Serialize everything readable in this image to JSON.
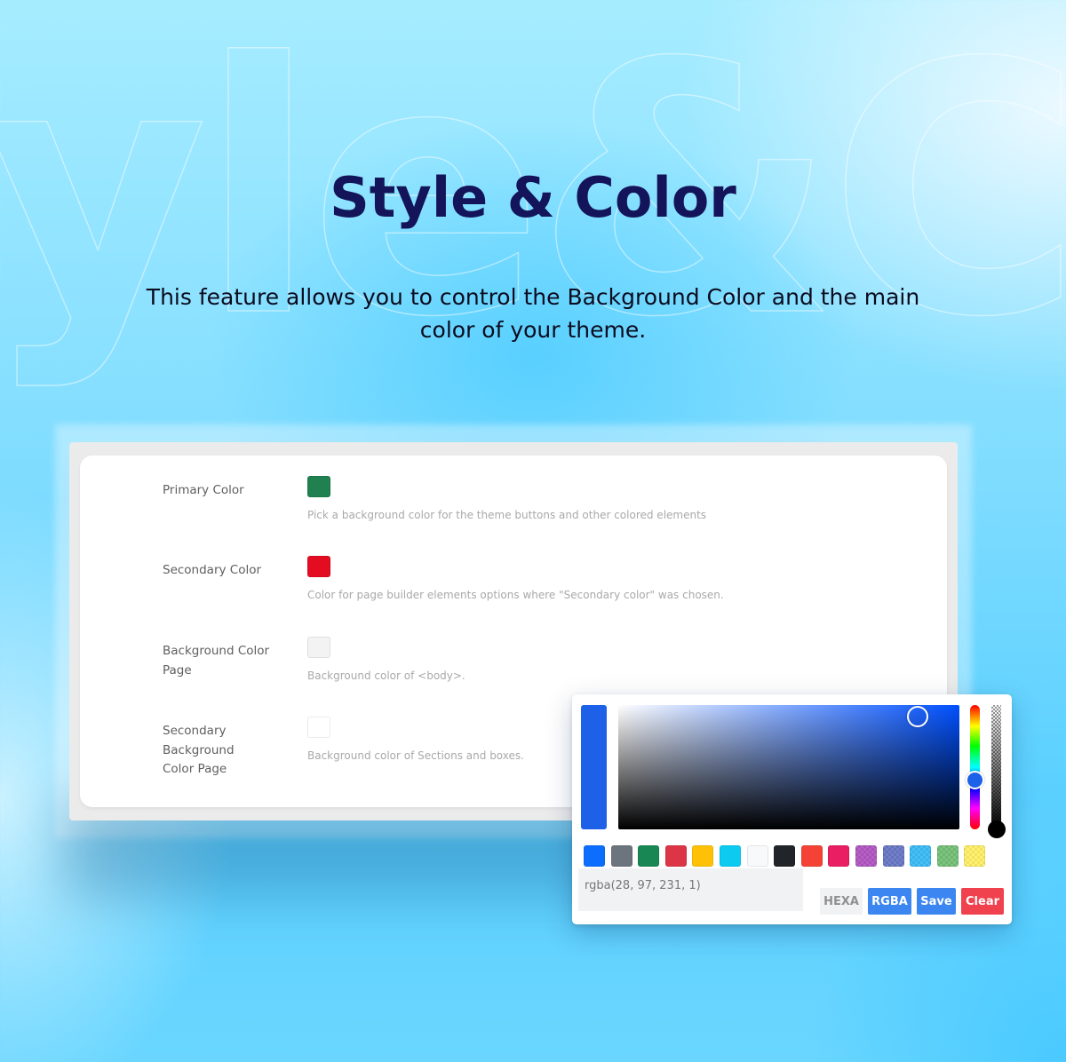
{
  "hero": {
    "watermark": "yle&Co",
    "title": "Style & Color",
    "subtitle": "This feature allows you to control the Background Color and the main color of your theme."
  },
  "settings": {
    "rows": [
      {
        "label": "Primary Color",
        "color": "#21804f",
        "description": "Pick a background color for the theme buttons and other colored elements"
      },
      {
        "label": "Secondary Color",
        "color": "#e30c21",
        "description": "Color for page builder elements options where \"Secondary color\" was chosen."
      },
      {
        "label": "Background Color Page",
        "color": "#f3f3f3",
        "description": "Background color of <body>."
      },
      {
        "label": "Secondary Background Color Page",
        "color": "#ffffff",
        "description": "Background color of Sections and boxes."
      }
    ]
  },
  "picker": {
    "current_color": "#1c61e7",
    "value": "rgba(28, 97, 231, 1)",
    "hue_color": "#0050ff",
    "swatches": [
      {
        "name": "blue",
        "color": "#0d6efd",
        "transparent": false
      },
      {
        "name": "gray",
        "color": "#6c757d",
        "transparent": false
      },
      {
        "name": "green",
        "color": "#198754",
        "transparent": false
      },
      {
        "name": "red",
        "color": "#dc3545",
        "transparent": false
      },
      {
        "name": "amber",
        "color": "#ffc107",
        "transparent": false
      },
      {
        "name": "cyan",
        "color": "#0dcaf0",
        "transparent": false
      },
      {
        "name": "light",
        "color": "#f8f9fa",
        "transparent": false
      },
      {
        "name": "dark",
        "color": "#212529",
        "transparent": false
      },
      {
        "name": "orange-red",
        "color": "#f44336",
        "transparent": false
      },
      {
        "name": "pink",
        "color": "#e91e63",
        "transparent": false
      },
      {
        "name": "purple",
        "color": "#9c27b0",
        "transparent": true
      },
      {
        "name": "indigo",
        "color": "#3f51b5",
        "transparent": true
      },
      {
        "name": "light-blue",
        "color": "#03a9f4",
        "transparent": true
      },
      {
        "name": "light-green",
        "color": "#4caf50",
        "transparent": true
      },
      {
        "name": "yellow",
        "color": "#ffeb3b",
        "transparent": true
      }
    ],
    "buttons": {
      "hexa": "HEXA",
      "rgba": "RGBA",
      "save": "Save",
      "clear": "Clear"
    }
  }
}
